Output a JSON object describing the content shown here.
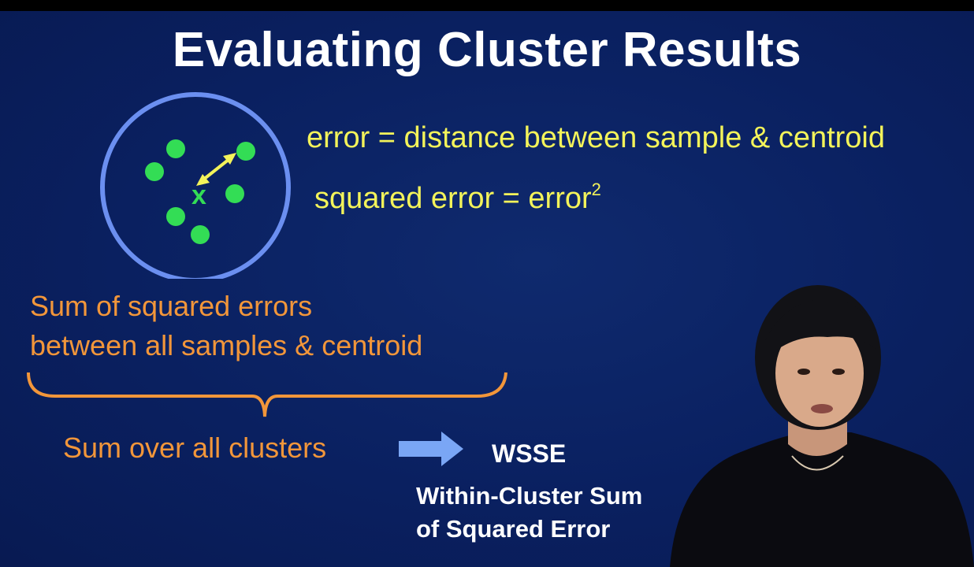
{
  "slide": {
    "title": "Evaluating Cluster Results",
    "error_definition": "error = distance between sample & centroid",
    "squared_error_text": "squared error = error",
    "squared_error_superscript": "2",
    "centroid_marker": "x",
    "sum_squared_line1": "Sum of squared errors",
    "sum_squared_line2": "between all samples & centroid",
    "sum_over_clusters": "Sum over all clusters",
    "wsse_acronym": "WSSE",
    "wsse_line1": "Within-Cluster Sum",
    "wsse_line2": "of Squared Error"
  },
  "colors": {
    "background": "#0a2060",
    "title": "#ffffff",
    "yellow_text": "#f3f35a",
    "orange_text": "#f2963a",
    "cluster_circle": "#6b8ff0",
    "points": "#33dd55",
    "arrow": "#7aa6f5"
  }
}
